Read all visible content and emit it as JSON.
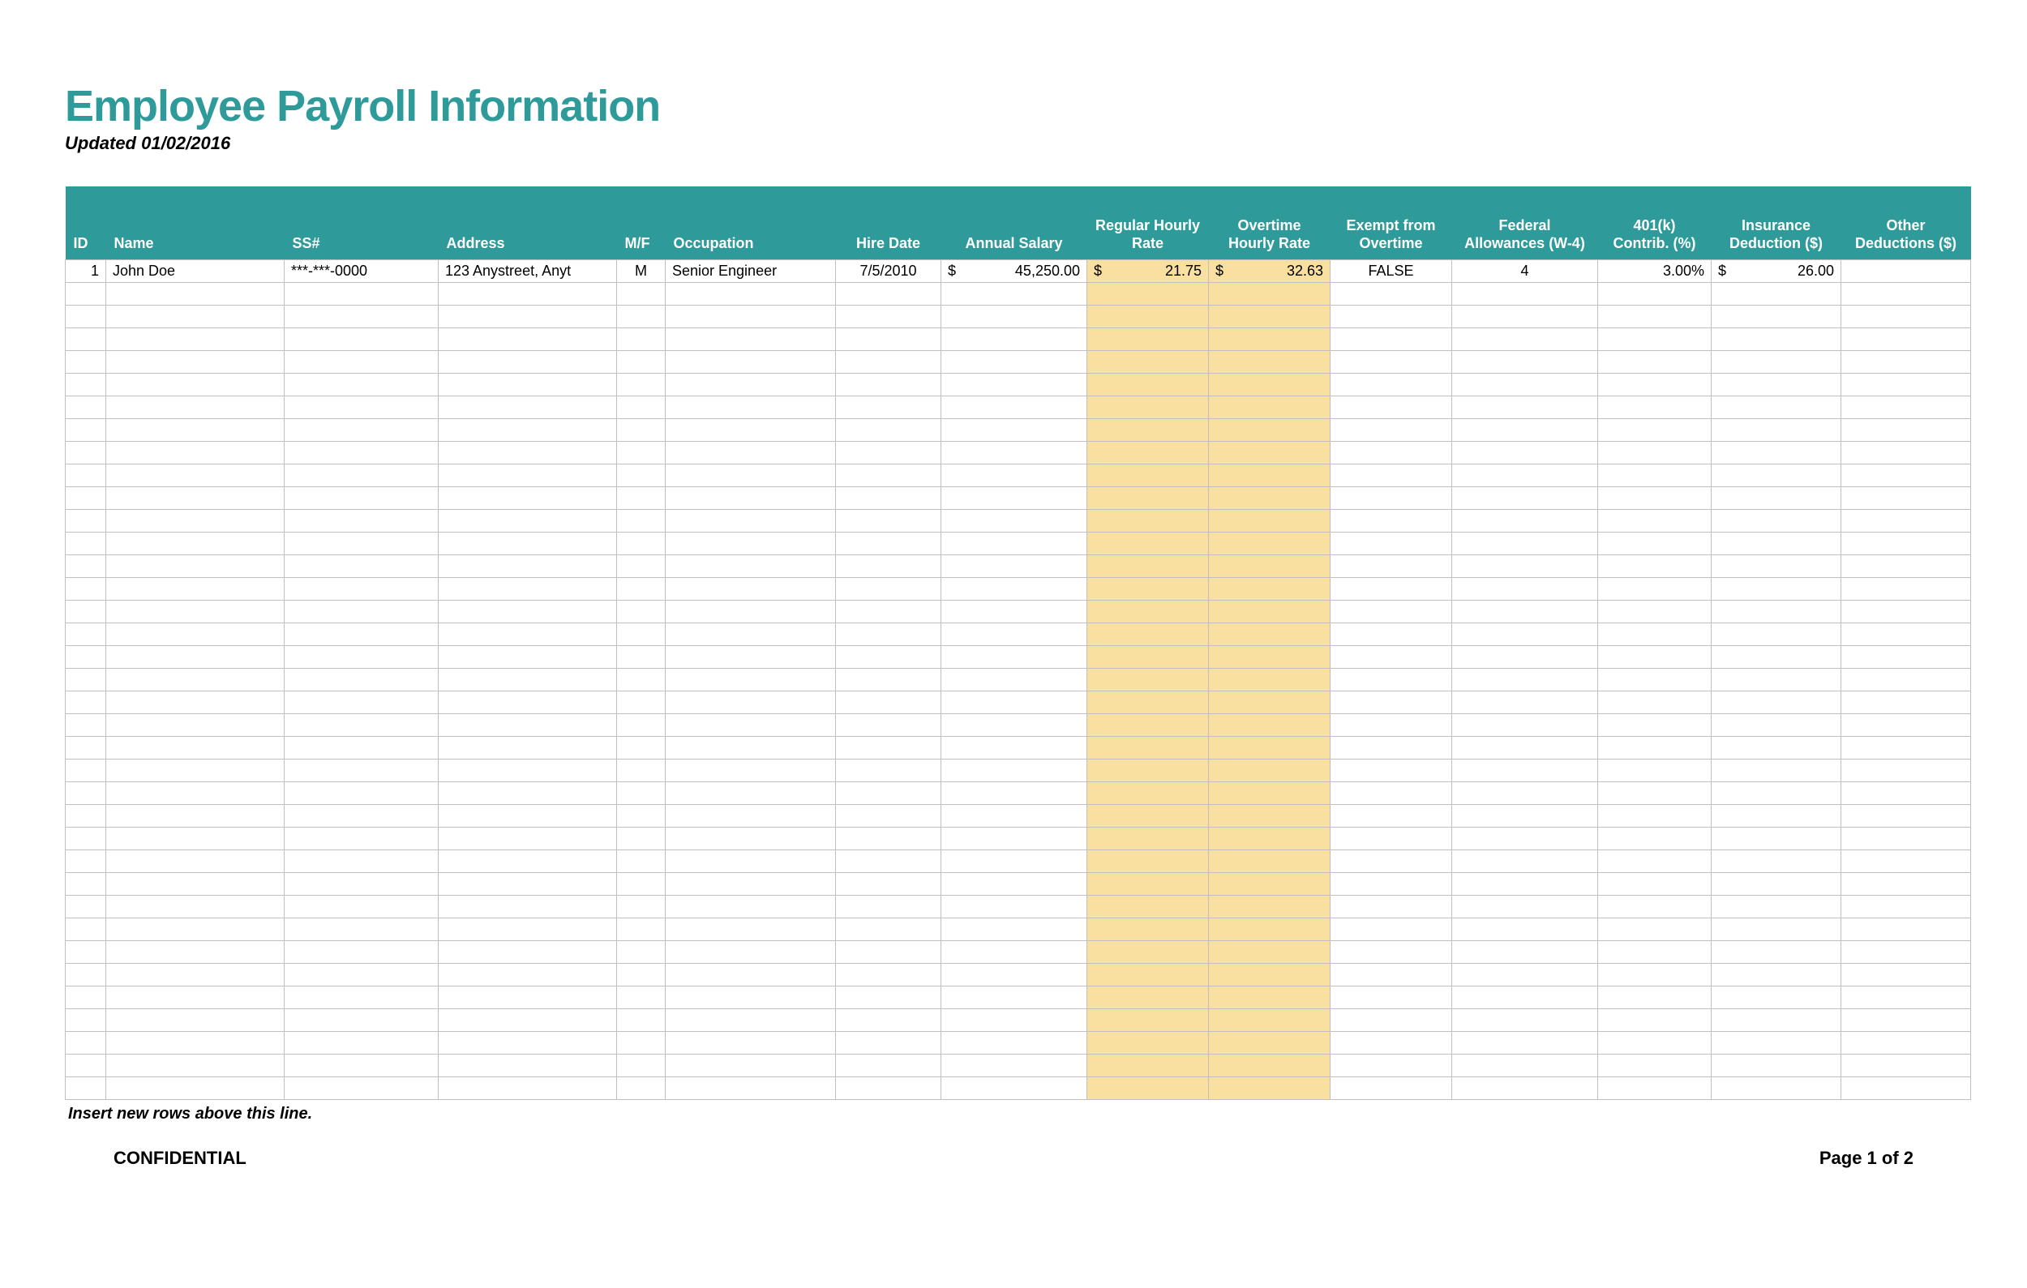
{
  "title": "Employee Payroll Information",
  "subtitle": "Updated 01/02/2016",
  "columns": {
    "id": "ID",
    "name": "Name",
    "ss": "SS#",
    "address": "Address",
    "mf": "M/F",
    "occupation": "Occupation",
    "hire_date": "Hire Date",
    "annual_salary": "Annual Salary",
    "regular_rate": "Regular Hourly Rate",
    "overtime_rate": "Overtime Hourly Rate",
    "exempt": "Exempt from Overtime",
    "fed_allow": "Federal Allowances (W-4)",
    "k401": "401(k) Contrib. (%)",
    "insurance": "Insurance Deduction ($)",
    "other": "Other Deductions ($)"
  },
  "row": {
    "id": "1",
    "name": "John Doe",
    "ss": "***-***-0000",
    "address": "123 Anystreet, Anyt",
    "mf": "M",
    "occupation": "Senior Engineer",
    "hire_date": "7/5/2010",
    "annual_salary": "45,250.00",
    "regular_rate": "21.75",
    "overtime_rate": "32.63",
    "exempt": "FALSE",
    "fed_allow": "4",
    "k401": "3.00%",
    "insurance": "26.00",
    "other": ""
  },
  "currency": "$",
  "empty_rows": 36,
  "insert_note": "Insert new rows above this line.",
  "footer": {
    "left": "CONFIDENTIAL",
    "right": "Page 1 of 2"
  },
  "colors": {
    "header_teal": "#2e9a9a",
    "shade_yellow": "#f9e0a0"
  }
}
